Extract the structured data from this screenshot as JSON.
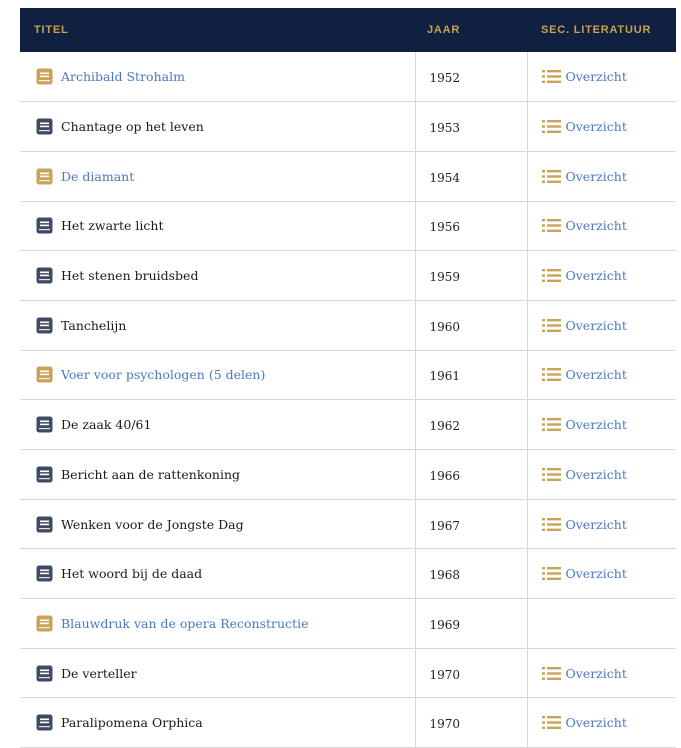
{
  "table": {
    "headers": {
      "title": "TITEL",
      "year": "JAAR",
      "literature": "SEC. LITERATUUR"
    },
    "rows": [
      {
        "title": "Archibald Strohalm",
        "year": "1952",
        "linked": true,
        "overview": "Overzicht"
      },
      {
        "title": "Chantage op het leven",
        "year": "1953",
        "linked": false,
        "overview": "Overzicht"
      },
      {
        "title": "De diamant",
        "year": "1954",
        "linked": true,
        "overview": "Overzicht"
      },
      {
        "title": "Het zwarte licht",
        "year": "1956",
        "linked": false,
        "overview": "Overzicht"
      },
      {
        "title": "Het stenen bruidsbed",
        "year": "1959",
        "linked": false,
        "overview": "Overzicht"
      },
      {
        "title": "Tanchelijn",
        "year": "1960",
        "linked": false,
        "overview": "Overzicht"
      },
      {
        "title": "Voer voor psychologen (5 delen)",
        "year": "1961",
        "linked": true,
        "overview": "Overzicht"
      },
      {
        "title": "De zaak 40/61",
        "year": "1962",
        "linked": false,
        "overview": "Overzicht"
      },
      {
        "title": "Bericht aan de rattenkoning",
        "year": "1966",
        "linked": false,
        "overview": "Overzicht"
      },
      {
        "title": "Wenken voor de Jongste Dag",
        "year": "1967",
        "linked": false,
        "overview": "Overzicht"
      },
      {
        "title": "Het woord bij de daad",
        "year": "1968",
        "linked": false,
        "overview": "Overzicht"
      },
      {
        "title": "Blauwdruk van de opera Reconstructie",
        "year": "1969",
        "linked": true,
        "overview": ""
      },
      {
        "title": "De verteller",
        "year": "1970",
        "linked": false,
        "overview": "Overzicht"
      },
      {
        "title": "Paralipomena Orphica",
        "year": "1970",
        "linked": false,
        "overview": "Overzicht"
      }
    ]
  },
  "colors": {
    "header_bg": "#0f2040",
    "header_text": "#c8a24e",
    "link": "#4a78c2",
    "icon_gold": "#c9a35a",
    "icon_dark": "#3f4a63"
  },
  "icons": {
    "book": "book-icon",
    "list": "list-icon"
  }
}
